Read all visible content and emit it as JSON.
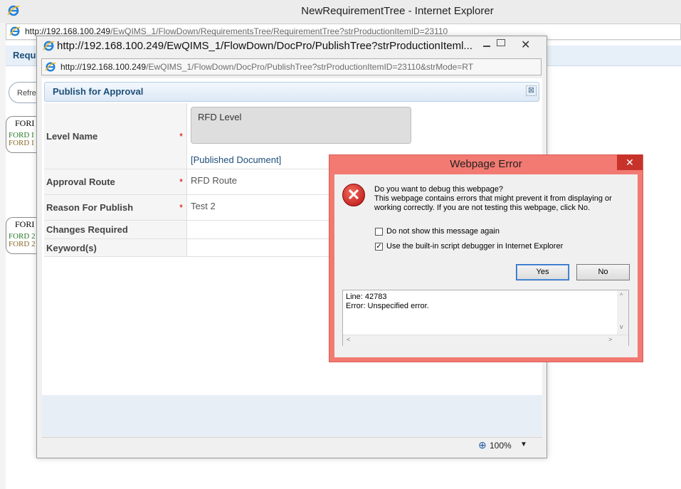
{
  "main_window": {
    "title": "NewRequirementTree - Internet Explorer",
    "address": {
      "host": "http://192.168.100.249",
      "path": "/EwQIMS_1/FlowDown/RequirementsTree/RequirementTree?strProductionItemID=23110"
    },
    "header_text": "Requi",
    "refresh_label": "Refre",
    "tree_nodes": [
      {
        "label": "FORI",
        "line1": "FORD I",
        "line2": "FORD I"
      },
      {
        "label": "FORI",
        "line1": "FORD 2",
        "line2": "FORD 2"
      }
    ]
  },
  "popup_window": {
    "title": "http://192.168.100.249/EwQIMS_1/FlowDown/DocPro/PublishTree?strProductionIteml...",
    "address": {
      "host": "http://192.168.100.249",
      "path": "/EwQIMS_1/FlowDown/DocPro/PublishTree?strProductionItemID=23110&strMode=RT"
    },
    "zoom": "100%"
  },
  "form": {
    "title": "Publish for Approval",
    "collapse_glyph": "⊠",
    "required_mark": "*",
    "rows": [
      {
        "label": "Level Name",
        "required": true,
        "value": "RFD Level",
        "link": "[Published Document]"
      },
      {
        "label": "Approval Route",
        "required": true,
        "value": "RFD Route"
      },
      {
        "label": "Reason For Publish",
        "required": true,
        "value": "Test 2"
      },
      {
        "label": "Changes Required",
        "required": false,
        "value": ""
      },
      {
        "label": "Keyword(s)",
        "required": false,
        "value": ""
      }
    ]
  },
  "error_dialog": {
    "title": "Webpage Error",
    "question": "Do you want to debug this webpage?",
    "message": "This webpage contains errors that might prevent it from displaying or working correctly. If you are not testing this webpage, click No.",
    "checkbox_1": {
      "label": "Do not show this message again",
      "checked": false
    },
    "checkbox_2": {
      "label": "Use the built-in script debugger in Internet Explorer",
      "checked": true
    },
    "yes_label": "Yes",
    "no_label": "No",
    "detail_line": "Line: 42783",
    "detail_error": "Error: Unspecified error."
  },
  "colors": {
    "error_frame": "#f37a72",
    "close_red": "#c7332a",
    "link_blue": "#1e4e79"
  }
}
